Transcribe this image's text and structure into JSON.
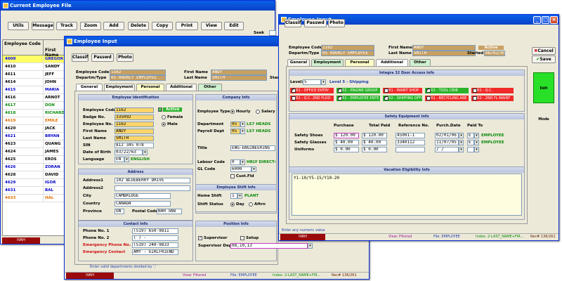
{
  "win1": {
    "title": "Current Employee File",
    "toolbar": [
      "Utils",
      "Message",
      "Track",
      "Zoom",
      "Add",
      "Delete",
      "Copy",
      "Print",
      "View",
      "Edit"
    ],
    "seek_label": "Seek",
    "columns": [
      "Employee Code",
      "First Name"
    ],
    "rows": [
      {
        "code": "4609",
        "name": "GREGOR",
        "color": "#0000ff",
        "bg": "#ffff66"
      },
      {
        "code": "4610",
        "name": "SANDY",
        "color": "#000000",
        "bg": "#ffffff"
      },
      {
        "code": "4611",
        "name": "JEFF",
        "color": "#000000",
        "bg": "#ffffff"
      },
      {
        "code": "4614",
        "name": "JOHN",
        "color": "#000000",
        "bg": "#ffffff"
      },
      {
        "code": "4615",
        "name": "MARIA",
        "color": "#0000cc",
        "bg": "#ffffff"
      },
      {
        "code": "4616",
        "name": "ARNOT",
        "color": "#000000",
        "bg": "#ffffff"
      },
      {
        "code": "4617",
        "name": "DON",
        "color": "#0a8a0a",
        "bg": "#ffffff"
      },
      {
        "code": "4618",
        "name": "RICHARD",
        "color": "#0a8a0a",
        "bg": "#ffffff"
      },
      {
        "code": "4619",
        "name": "EMILE",
        "color": "#e07000",
        "bg": "#ffffff"
      },
      {
        "code": "4620",
        "name": "JACK",
        "color": "#000000",
        "bg": "#ffffff"
      },
      {
        "code": "4621",
        "name": "BRYAN",
        "color": "#0000cc",
        "bg": "#ffffff"
      },
      {
        "code": "4623",
        "name": "QUANG",
        "color": "#000000",
        "bg": "#ffffff"
      },
      {
        "code": "4624",
        "name": "JAMES",
        "color": "#000000",
        "bg": "#ffffff"
      },
      {
        "code": "4625",
        "name": "EROS",
        "color": "#000000",
        "bg": "#ffffff"
      },
      {
        "code": "4626",
        "name": "ZORAN",
        "color": "#0000cc",
        "bg": "#ffffff"
      },
      {
        "code": "4628",
        "name": "DAVID",
        "color": "#000000",
        "bg": "#ffffff"
      },
      {
        "code": "4629",
        "name": "IGOR",
        "color": "#0000cc",
        "bg": "#ffffff"
      },
      {
        "code": "4631",
        "name": "BAL",
        "color": "#0000cc",
        "bg": "#ffffff"
      },
      {
        "code": "4633",
        "name": "HAL",
        "color": "#e07000",
        "bg": "#ffffff"
      }
    ],
    "status_user": "IVAH"
  },
  "win2": {
    "title": "Employee Input",
    "toolbar": [
      "Classif",
      "Passwd",
      "Photo"
    ],
    "header": {
      "code_label": "Employee Code",
      "code": "1162",
      "dept_label": "Departm/Type",
      "dept": "05 HOURLY EMPLOYEE",
      "first_label": "First Name",
      "first": "ANDY",
      "last_label": "Last Name",
      "last": "SMITH",
      "started_label": "Star"
    },
    "tabs": [
      "General",
      "Employment",
      "Personal",
      "Additional",
      "Other"
    ],
    "ident": {
      "title": "Employee Identification",
      "code_label": "Employee Code",
      "code": "1162",
      "active": "Active",
      "badge_label": "Badge No.",
      "badge": "335092",
      "female": "Female",
      "empno_label": "Employee No.",
      "empno": "1162",
      "male": "Male",
      "first_label": "First Name",
      "first": "ANDY",
      "last_label": "Last Name",
      "last": "SMITH",
      "sin_label": "SIN",
      "sin": "812 345 078",
      "dob_label": "Date of Birth",
      "dob": "03/22/63",
      "lang_label": "Language",
      "lang": "EN",
      "lang_name": "ENGLISH"
    },
    "address": {
      "title": "Address",
      "addr1_label": "Address1",
      "addr1": "102 BLUEBERRY DRIVE",
      "addr2_label": "Address2",
      "addr2": "",
      "city_label": "City",
      "city": "CAMBRIDGE",
      "country_label": "Country",
      "country": "CANADA",
      "prov_label": "Province",
      "prov": "ON",
      "postal_label": "Postal Code",
      "postal": "N4H 5N8"
    },
    "contact": {
      "title": "Contact Info",
      "p1_label": "Phone No. 1",
      "p1": "(519) 650-9811",
      "p2_label": "Phone No. 2",
      "p2": "(   )    -",
      "ep_label": "Emergency Phone No.",
      "ep": "(519) 240-9833",
      "ec_label": "Emergency Contact",
      "ec": "AMY - GIRLFRIEND"
    },
    "company": {
      "title": "Company Info",
      "type_label": "Employee Type",
      "hourly": "Hourly",
      "salary": "Salary",
      "dept_label": "Department",
      "dept": "05",
      "dept_name": "LS7 HEADS",
      "payroll_label": "Payroll Dept",
      "payroll": "05",
      "payroll_name": "LS7 HEADS",
      "title_label": "Title",
      "title_val": "ENG-ENGINEERING",
      "labour_label": "Labour Code",
      "labour": "0",
      "labour_name": "HRLY DIRECT-REG",
      "gl_label": "GL Code",
      "gl": "6000",
      "custfld": "Cust.Fld"
    },
    "shift": {
      "title": "Employee Shift Info",
      "home_label": "Home Shift",
      "home": "1",
      "home_name": "PLANT",
      "status_label": "Shift Status",
      "day": "Day",
      "aftrn": "Aftrn"
    },
    "position": {
      "title": "Position Info",
      "supervisor": "Supervisor",
      "setup": "Setup",
      "sup_dept_label": "Supervisor Dept",
      "sup_dept": "08,10,13"
    },
    "hint": "Enter valid departments divided by ','",
    "status": [
      "IVAH",
      "View: Filtered",
      "File: EMPLOYEE",
      "Index: 2-LAST_NAME+FIR...",
      "Rec# 136/261"
    ]
  },
  "win3": {
    "title": "Employee Input",
    "toolbar": [
      "Classif",
      "Passwd",
      "Photo"
    ],
    "header": {
      "code_label": "Employee Code",
      "code": "1162",
      "dept_label": "Departm/Type",
      "dept": "05 HOURLY EMPLOYEE",
      "first_label": "First Name",
      "first": "ANDY",
      "last_label": "Last Name",
      "last": "SMITH",
      "active": "Active",
      "started_label": "Started",
      "started": "06/02/95"
    },
    "tabs": [
      "General",
      "Employment",
      "Personal",
      "Additional",
      "Other"
    ],
    "side_buttons": {
      "cancel": "Cancel",
      "save": "Save",
      "mode": "Edit Mode"
    },
    "integra": {
      "title": "Integra 32 Door Access Info",
      "level_label": "Level:",
      "level": "5",
      "level_name": "Level 5 - Shipping",
      "access": [
        {
          "label": "R1 - OFFICE ENTRY",
          "checked": true,
          "color": "red"
        },
        {
          "label": "R2 - ENGINE GROUP",
          "checked": true,
          "color": "green"
        },
        {
          "label": "R1 - MAINT SHOP",
          "checked": false,
          "color": "red"
        },
        {
          "label": "R2 - TOOL CRIB",
          "checked": true,
          "color": "green"
        },
        {
          "label": "R1 - Q.C.",
          "checked": false,
          "color": "red"
        },
        {
          "label": "R2 - Q.C. 2ND FLOO",
          "checked": false,
          "color": "red"
        },
        {
          "label": "R1 - EMPLOYEE ENTE",
          "checked": true,
          "color": "green"
        },
        {
          "label": "R2 - SHIPPING OFFI",
          "checked": true,
          "color": "green"
        },
        {
          "label": "R1 - RECYCLING ARE",
          "checked": false,
          "color": "red"
        },
        {
          "label": "R2 - 2ND FL MAINT",
          "checked": false,
          "color": "red"
        }
      ]
    },
    "safety": {
      "title": "Safety Equipment Info",
      "headers": [
        "Purchase",
        "Total Paid",
        "Reference No.",
        "Purch.Date",
        "Paid To"
      ],
      "rows": [
        {
          "label": "Safety Shoes",
          "purchase": "$ 120.00",
          "total": "$ 120.00",
          "ref": "45001-1",
          "date": "02/01/06",
          "paid": "E",
          "paid_name": "EMPLOYEE"
        },
        {
          "label": "Safety Glasses",
          "purchase": "$  40.00",
          "total": "$  40.00",
          "ref": "3340112",
          "date": "11/07/05",
          "paid": "E",
          "paid_name": "EMPLOYEE"
        },
        {
          "label": "Uniforms",
          "purchase": "$   0.00",
          "total": "$   0.00",
          "ref": "",
          "date": " /  /",
          "paid": "",
          "paid_name": ""
        }
      ]
    },
    "vacation": {
      "title": "Vacation Eligibility Info",
      "text": "Y1-10/Y5-15/Y10-20"
    },
    "hint": "Enter any numeric value",
    "status": [
      "IVAH",
      "View: Filtered",
      "File: EMPLOYEE",
      "Index: 2-LAST_NAME+FIR...",
      "Rec# 136/261"
    ]
  }
}
